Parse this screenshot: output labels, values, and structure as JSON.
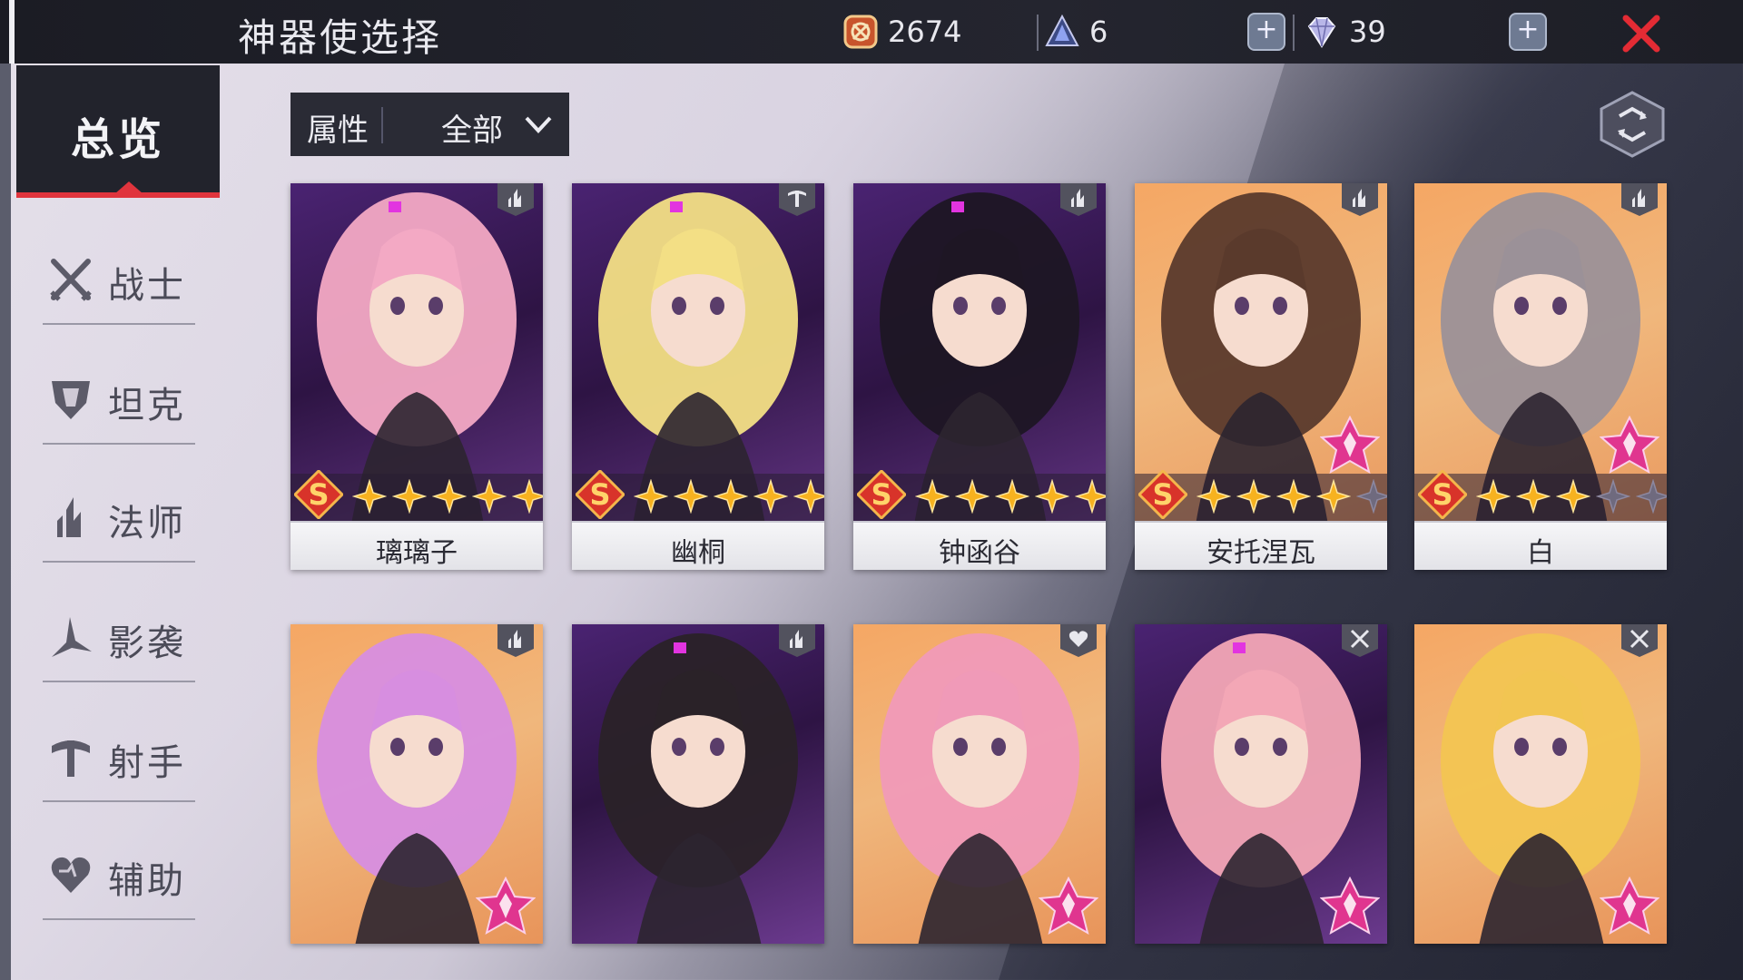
{
  "header": {
    "title": "神器使选择",
    "gold": "2674",
    "stamina": "6",
    "diamonds": "39"
  },
  "sidebar": {
    "overview": "总览",
    "roles": [
      {
        "label": "战士",
        "icon": "sword-cross-icon"
      },
      {
        "label": "坦克",
        "icon": "shield-helmet-icon"
      },
      {
        "label": "法师",
        "icon": "flame-staff-icon"
      },
      {
        "label": "影袭",
        "icon": "shadow-blade-icon"
      },
      {
        "label": "射手",
        "icon": "crossbow-icon"
      },
      {
        "label": "辅助",
        "icon": "heart-icon"
      }
    ]
  },
  "filter": {
    "label": "属性",
    "value": "全部"
  },
  "cards": [
    {
      "name": "璃璃子",
      "rank": "S",
      "stars": 5,
      "class_icon": "mage-icon",
      "theme": "purple",
      "hair": "#f3a9c4"
    },
    {
      "name": "幽桐",
      "rank": "S",
      "stars": 5,
      "class_icon": "marksman-icon",
      "theme": "purple",
      "hair": "#f3df85"
    },
    {
      "name": "钟函谷",
      "rank": "S",
      "stars": 5,
      "class_icon": "mage-icon",
      "theme": "purple",
      "hair": "#1e1624"
    },
    {
      "name": "安托涅瓦",
      "rank": "S",
      "stars": 4,
      "class_icon": "mage-icon",
      "theme": "orange",
      "hair": "#5a3a2c"
    },
    {
      "name": "白",
      "rank": "S",
      "stars": 3,
      "class_icon": "mage-icon",
      "theme": "orange",
      "hair": "#9b9198"
    },
    {
      "class_icon": "mage-icon",
      "theme": "orange",
      "hair": "#d78ee0"
    },
    {
      "class_icon": "mage-icon",
      "theme": "purple",
      "hair": "#2a2228"
    },
    {
      "class_icon": "support-icon",
      "theme": "orange",
      "hair": "#f09ab8"
    },
    {
      "class_icon": "warrior-icon",
      "theme": "purple",
      "hair": "#f3a7b6"
    },
    {
      "class_icon": "warrior-icon",
      "theme": "orange",
      "hair": "#f2c552"
    }
  ]
}
